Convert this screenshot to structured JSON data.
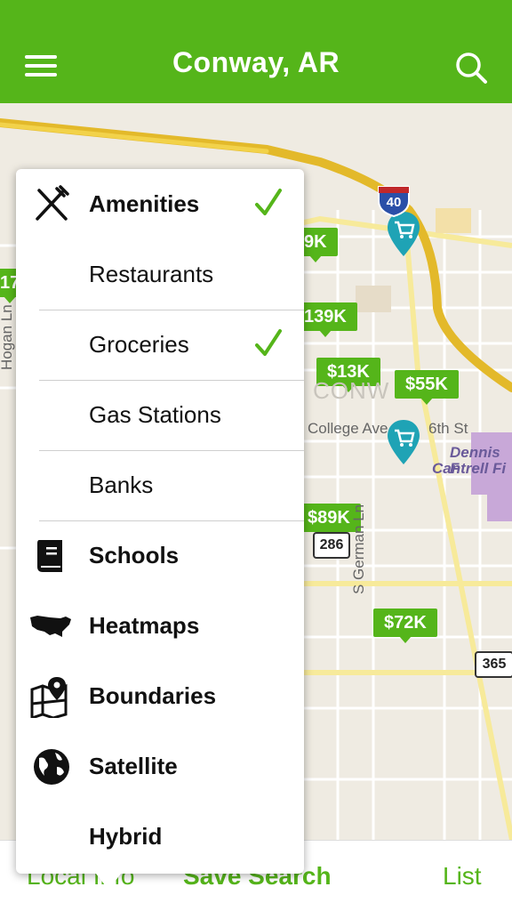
{
  "header": {
    "title": "Conway, AR",
    "menu_icon": "hamburger-menu-icon",
    "search_icon": "search-icon"
  },
  "map": {
    "prices": [
      "9K",
      "139K",
      "$13K",
      "$55K",
      "$89K",
      "$72K"
    ],
    "edge_price": "17",
    "streets": [
      "College Ave",
      "6th St",
      "S German Ln",
      "Hogan Ln"
    ],
    "place": [
      "Dennis F",
      "Cantrell Fi"
    ],
    "city_label": "CONW",
    "shields": {
      "interstate": "40",
      "route_286": "286",
      "route_365": "365"
    },
    "colors": {
      "price_green": "#55b51a",
      "pin_teal": "#1fa3b5"
    }
  },
  "dropdown": {
    "items": [
      {
        "label": "Amenities",
        "icon": "fork-knife-icon",
        "checked": true
      },
      {
        "label": "Restaurants",
        "checked": false
      },
      {
        "label": "Groceries",
        "checked": true
      },
      {
        "label": "Gas Stations",
        "checked": false
      },
      {
        "label": "Banks",
        "checked": false
      },
      {
        "label": "Schools",
        "icon": "book-icon"
      },
      {
        "label": "Heatmaps",
        "icon": "usa-map-icon"
      },
      {
        "label": "Boundaries",
        "icon": "boundary-map-pin-icon"
      },
      {
        "label": "Satellite",
        "icon": "globe-icon"
      },
      {
        "label": "Hybrid"
      }
    ]
  },
  "bottom_bar": {
    "local_info": "Local Info",
    "save_search": "Save Search",
    "list": "List"
  }
}
